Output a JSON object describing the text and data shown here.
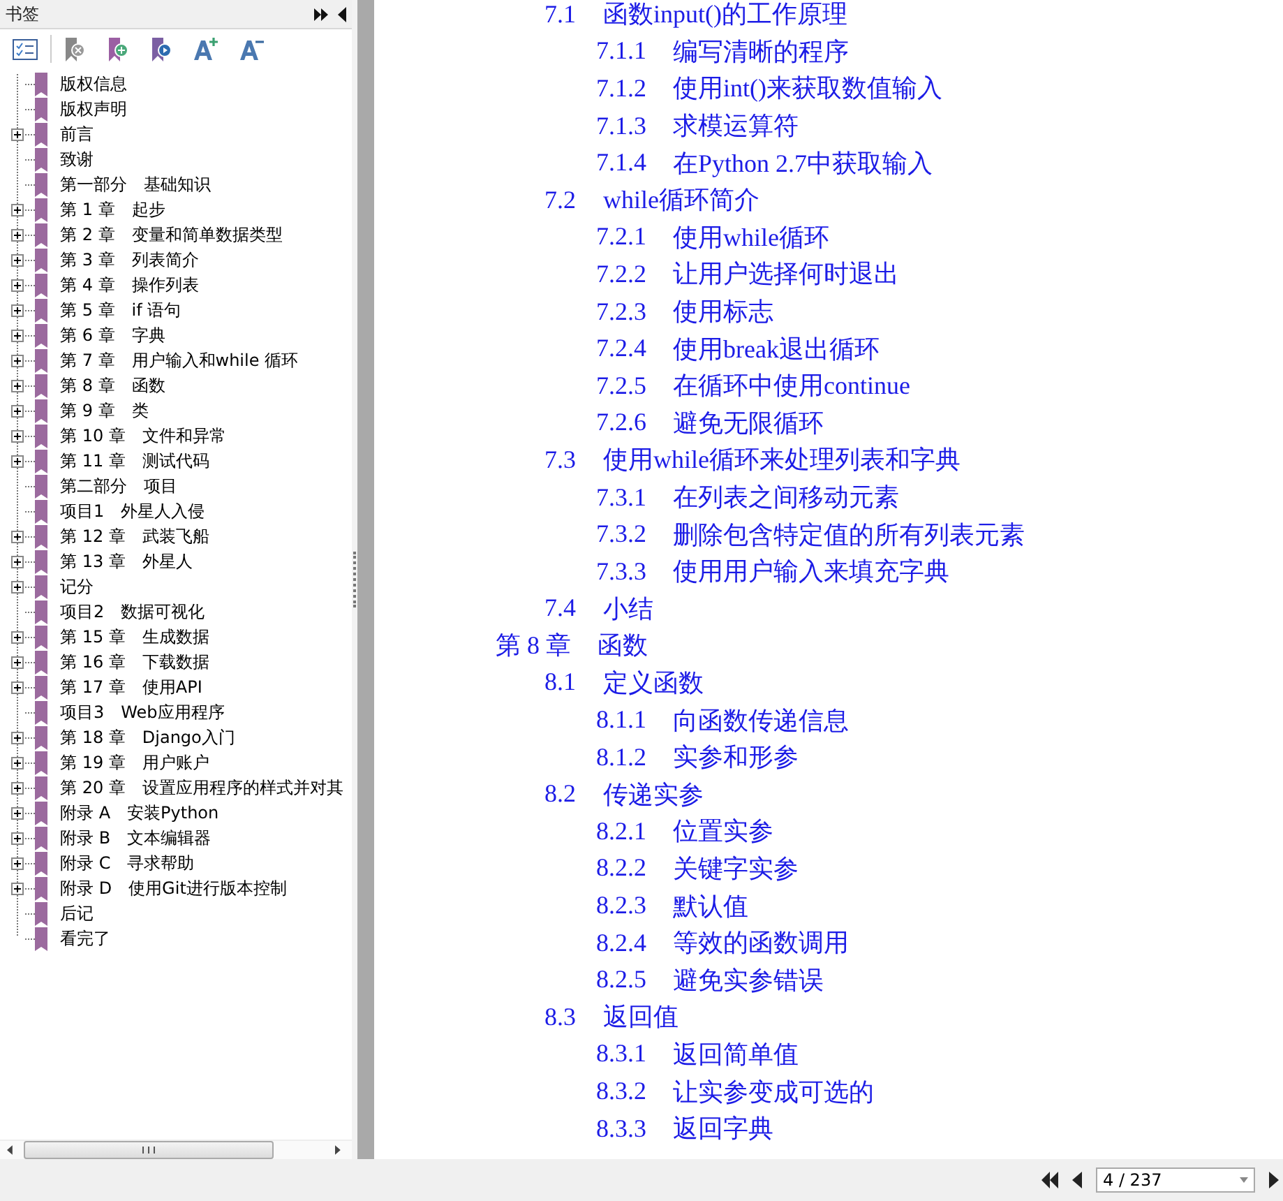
{
  "bookmarks_panel": {
    "title": "书签",
    "tree": [
      {
        "label": "版权信息",
        "kind": "leaf"
      },
      {
        "label": "版权声明",
        "kind": "leaf"
      },
      {
        "label": "前言",
        "kind": "branch"
      },
      {
        "label": "致谢",
        "kind": "leaf"
      },
      {
        "label": "第一部分　基础知识",
        "kind": "leaf"
      },
      {
        "label": "第 1 章　起步",
        "kind": "branch"
      },
      {
        "label": "第 2 章　变量和简单数据类型",
        "kind": "branch"
      },
      {
        "label": "第 3 章　列表简介",
        "kind": "branch"
      },
      {
        "label": "第 4 章　操作列表",
        "kind": "branch"
      },
      {
        "label": "第 5 章　if 语句",
        "kind": "branch"
      },
      {
        "label": "第 6 章　字典",
        "kind": "branch"
      },
      {
        "label": "第 7 章　用户输入和while 循环",
        "kind": "branch"
      },
      {
        "label": "第 8 章　函数",
        "kind": "branch"
      },
      {
        "label": "第 9 章　类",
        "kind": "branch"
      },
      {
        "label": "第 10 章　文件和异常",
        "kind": "branch"
      },
      {
        "label": "第 11 章　测试代码",
        "kind": "branch"
      },
      {
        "label": "第二部分　项目",
        "kind": "leaf"
      },
      {
        "label": "项目1　外星人入侵",
        "kind": "leaf"
      },
      {
        "label": "第 12 章　武装飞船",
        "kind": "branch"
      },
      {
        "label": "第 13 章　外星人",
        "kind": "branch"
      },
      {
        "label": "记分",
        "kind": "branch"
      },
      {
        "label": "项目2　数据可视化",
        "kind": "leaf"
      },
      {
        "label": "第 15 章　生成数据",
        "kind": "branch"
      },
      {
        "label": "第 16 章　下载数据",
        "kind": "branch"
      },
      {
        "label": "第 17 章　使用API",
        "kind": "branch"
      },
      {
        "label": "项目3　Web应用程序",
        "kind": "leaf"
      },
      {
        "label": "第 18 章　Django入门",
        "kind": "branch"
      },
      {
        "label": "第 19 章　用户账户",
        "kind": "branch"
      },
      {
        "label": "第 20 章　设置应用程序的样式并对其",
        "kind": "branch"
      },
      {
        "label": "附录 A　安装Python",
        "kind": "branch"
      },
      {
        "label": "附录 B　文本编辑器",
        "kind": "branch"
      },
      {
        "label": "附录 C　寻求帮助",
        "kind": "branch"
      },
      {
        "label": "附录 D　使用Git进行版本控制",
        "kind": "branch"
      },
      {
        "label": "后记",
        "kind": "leaf"
      },
      {
        "label": "看完了",
        "kind": "leaf"
      }
    ]
  },
  "page": {
    "toc": [
      {
        "sections": [
          {
            "number": "7.1",
            "title": "函数input()的工作原理",
            "children": [
              {
                "number": "7.1.1",
                "title": "编写清晰的程序"
              },
              {
                "number": "7.1.2",
                "title": "使用int()来获取数值输入"
              },
              {
                "number": "7.1.3",
                "title": "求模运算符"
              },
              {
                "number": "7.1.4",
                "title": "在Python 2.7中获取输入"
              }
            ]
          },
          {
            "number": "7.2",
            "title": "while循环简介",
            "children": [
              {
                "number": "7.2.1",
                "title": "使用while循环"
              },
              {
                "number": "7.2.2",
                "title": "让用户选择何时退出"
              },
              {
                "number": "7.2.3",
                "title": "使用标志"
              },
              {
                "number": "7.2.4",
                "title": "使用break退出循环"
              },
              {
                "number": "7.2.5",
                "title": "在循环中使用continue"
              },
              {
                "number": "7.2.6",
                "title": "避免无限循环"
              }
            ]
          },
          {
            "number": "7.3",
            "title": "使用while循环来处理列表和字典",
            "children": [
              {
                "number": "7.3.1",
                "title": "在列表之间移动元素"
              },
              {
                "number": "7.3.2",
                "title": "删除包含特定值的所有列表元素"
              },
              {
                "number": "7.3.3",
                "title": "使用用户输入来填充字典"
              }
            ]
          },
          {
            "number": "7.4",
            "title": "小结"
          }
        ]
      },
      {
        "number": "第 8 章",
        "title": "函数",
        "sections": [
          {
            "number": "8.1",
            "title": "定义函数",
            "children": [
              {
                "number": "8.1.1",
                "title": "向函数传递信息"
              },
              {
                "number": "8.1.2",
                "title": "实参和形参"
              }
            ]
          },
          {
            "number": "8.2",
            "title": "传递实参",
            "children": [
              {
                "number": "8.2.1",
                "title": "位置实参"
              },
              {
                "number": "8.2.2",
                "title": "关键字实参"
              },
              {
                "number": "8.2.3",
                "title": "默认值"
              },
              {
                "number": "8.2.4",
                "title": "等效的函数调用"
              },
              {
                "number": "8.2.5",
                "title": "避免实参错误"
              }
            ]
          },
          {
            "number": "8.3",
            "title": "返回值",
            "children": [
              {
                "number": "8.3.1",
                "title": "返回简单值"
              },
              {
                "number": "8.3.2",
                "title": "让实参变成可选的"
              },
              {
                "number": "8.3.3",
                "title": "返回字典"
              }
            ]
          }
        ]
      }
    ]
  },
  "navigation": {
    "page_field": "4 / 237"
  }
}
